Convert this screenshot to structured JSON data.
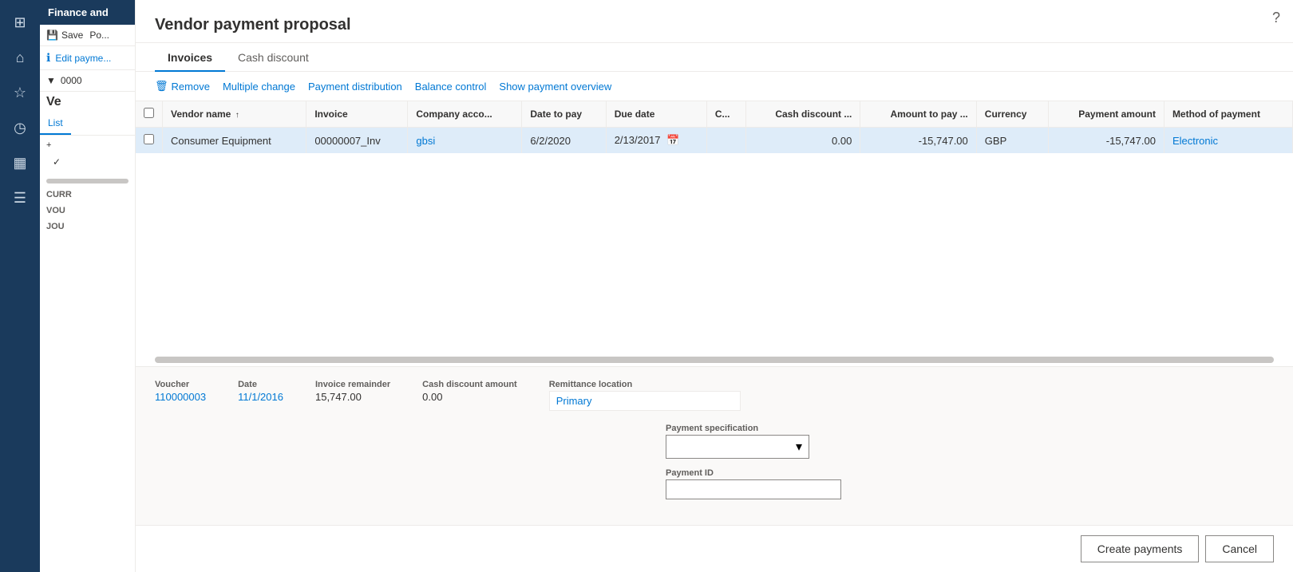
{
  "app": {
    "title": "Finance and",
    "help_icon": "?"
  },
  "sidebar": {
    "icons": [
      {
        "name": "grid-icon",
        "symbol": "⊞"
      },
      {
        "name": "home-icon",
        "symbol": "⌂"
      },
      {
        "name": "star-icon",
        "symbol": "☆"
      },
      {
        "name": "clock-icon",
        "symbol": "◷"
      },
      {
        "name": "grid2-icon",
        "symbol": "▦"
      },
      {
        "name": "list-icon",
        "symbol": "☰"
      }
    ]
  },
  "left_panel": {
    "header": "Finance and",
    "save_label": "Save",
    "post_label": "Po...",
    "edit_label": "Edit payme...",
    "filter_label": "0000",
    "ve_label": "Ve",
    "list_tab": "List",
    "add_btn": "+",
    "check_icon": "✓",
    "scroll_label": "CURR",
    "vol_label": "VOU",
    "jou_label": "JOU"
  },
  "modal": {
    "title": "Vendor payment proposal",
    "tabs": [
      {
        "id": "invoices",
        "label": "Invoices",
        "active": true
      },
      {
        "id": "cash-discount",
        "label": "Cash discount",
        "active": false
      }
    ],
    "toolbar": {
      "remove_label": "Remove",
      "multiple_change_label": "Multiple change",
      "payment_distribution_label": "Payment distribution",
      "balance_control_label": "Balance control",
      "show_payment_overview_label": "Show payment overview"
    },
    "table": {
      "columns": [
        {
          "id": "check",
          "label": ""
        },
        {
          "id": "vendor_name",
          "label": "Vendor name"
        },
        {
          "id": "invoice",
          "label": "Invoice"
        },
        {
          "id": "company_acco",
          "label": "Company acco..."
        },
        {
          "id": "date_to_pay",
          "label": "Date to pay"
        },
        {
          "id": "due_date",
          "label": "Due date"
        },
        {
          "id": "c",
          "label": "C..."
        },
        {
          "id": "cash_discount",
          "label": "Cash discount ..."
        },
        {
          "id": "amount_to_pay",
          "label": "Amount to pay ..."
        },
        {
          "id": "currency",
          "label": "Currency"
        },
        {
          "id": "payment_amount",
          "label": "Payment amount"
        },
        {
          "id": "method_of_payment",
          "label": "Method of payment"
        }
      ],
      "rows": [
        {
          "check": "",
          "vendor_name": "Consumer Equipment",
          "invoice": "00000007_Inv",
          "company_acco": "gbsi",
          "date_to_pay": "6/2/2020",
          "due_date": "2/13/2017",
          "c": "",
          "cash_discount": "0.00",
          "amount_to_pay": "-15,747.00",
          "currency": "GBP",
          "payment_amount": "-15,747.00",
          "method_of_payment": "Electronic"
        }
      ]
    },
    "details": {
      "voucher_label": "Voucher",
      "voucher_value": "110000003",
      "date_label": "Date",
      "date_value": "11/1/2016",
      "invoice_remainder_label": "Invoice remainder",
      "invoice_remainder_value": "15,747.00",
      "cash_discount_amount_label": "Cash discount amount",
      "cash_discount_amount_value": "0.00",
      "remittance_location_label": "Remittance location",
      "remittance_location_value": "Primary",
      "payment_specification_label": "Payment specification",
      "payment_specification_value": "",
      "payment_id_label": "Payment ID",
      "payment_id_value": ""
    },
    "footer": {
      "create_payments_label": "Create payments",
      "cancel_label": "Cancel"
    }
  }
}
